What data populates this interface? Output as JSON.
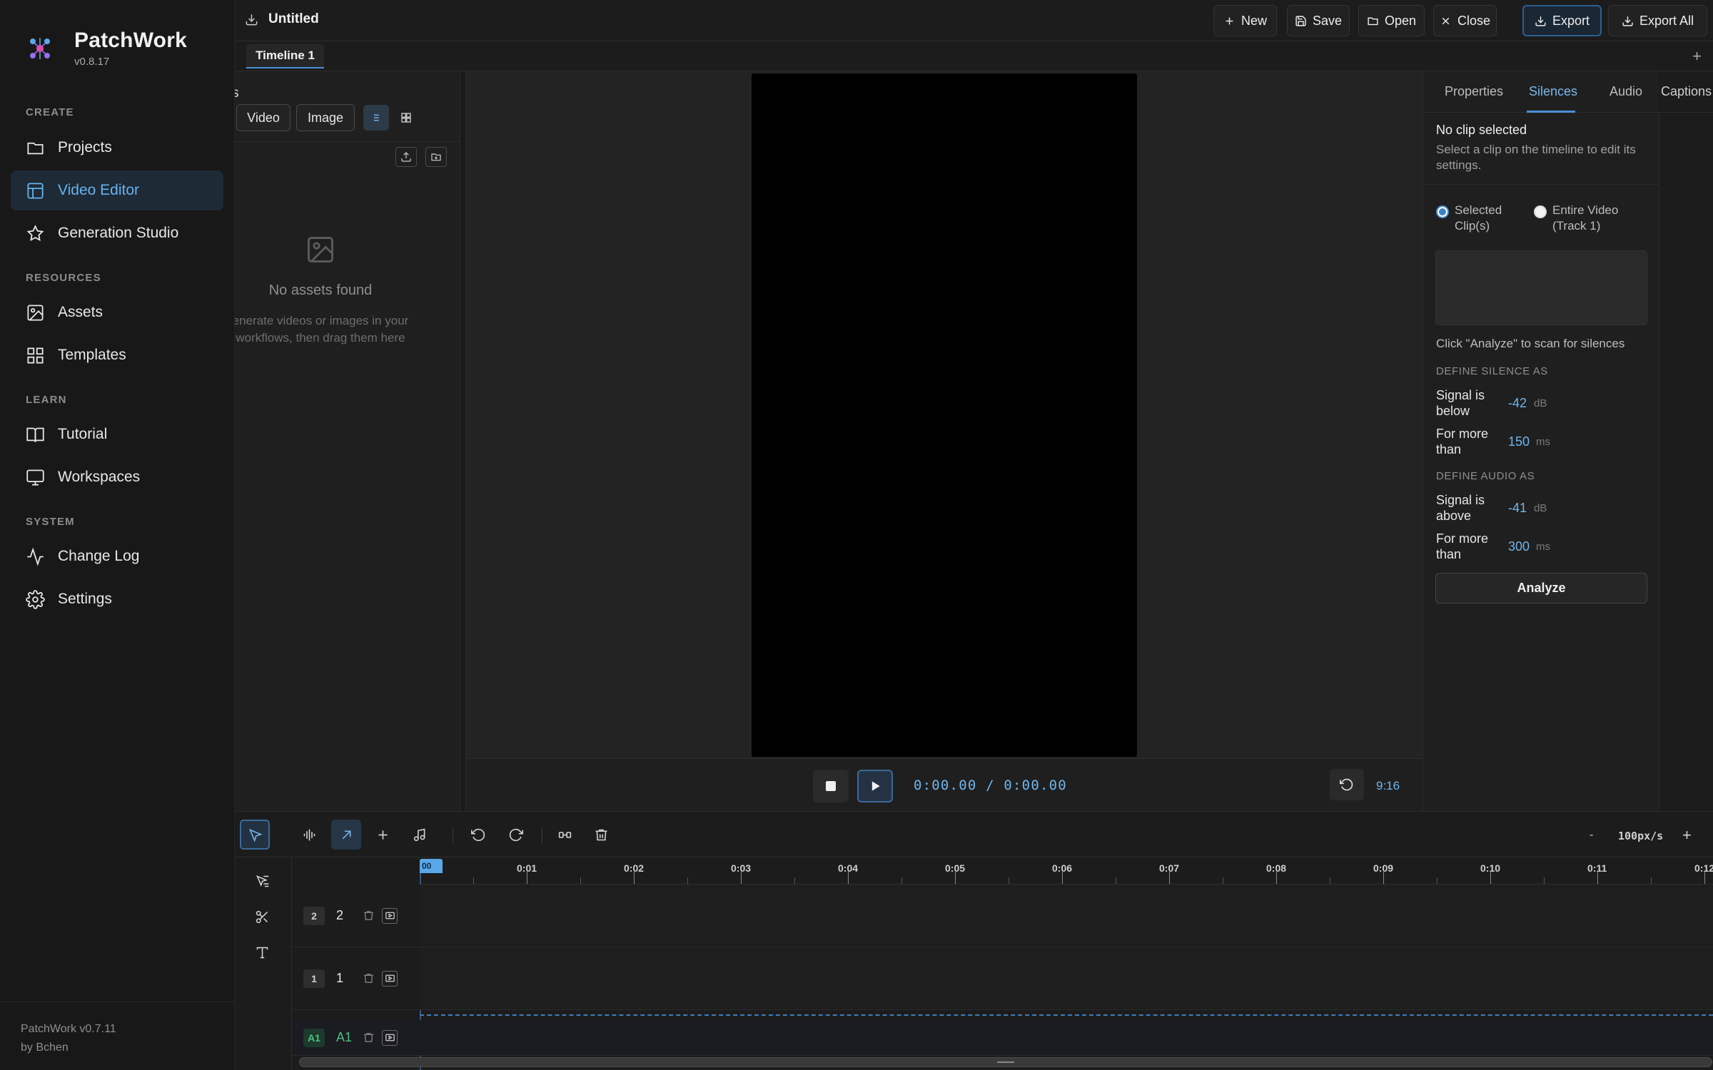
{
  "app": {
    "name": "PatchWork",
    "version": "v0.8.17"
  },
  "sidebar": {
    "sections": [
      {
        "label": "CREATE"
      },
      {
        "label": "RESOURCES"
      },
      {
        "label": "LEARN"
      },
      {
        "label": "SYSTEM"
      }
    ],
    "items": [
      {
        "label": "Projects",
        "icon": "folder-icon"
      },
      {
        "label": "Video Editor",
        "icon": "layout-icon",
        "active": true
      },
      {
        "label": "Generation Studio",
        "icon": "star-icon"
      },
      {
        "label": "Assets",
        "icon": "image-icon"
      },
      {
        "label": "Templates",
        "icon": "grid-icon"
      },
      {
        "label": "Tutorial",
        "icon": "book-icon"
      },
      {
        "label": "Workspaces",
        "icon": "monitor-icon"
      },
      {
        "label": "Change Log",
        "icon": "activity-icon"
      },
      {
        "label": "Settings",
        "icon": "gear-icon"
      }
    ],
    "footer": {
      "line1": "PatchWork v0.7.11",
      "line2": "by Bchen"
    }
  },
  "topbar": {
    "doc_title": "Untitled",
    "buttons": {
      "new": "New",
      "save": "Save",
      "open": "Open",
      "close": "Close",
      "export": "Export",
      "export_all": "Export All"
    }
  },
  "tabs": {
    "active": "Timeline 1",
    "add": "+"
  },
  "assets": {
    "title_fragment": "s",
    "filters": [
      "Video",
      "Image"
    ],
    "empty_title": "No assets found",
    "empty_sub_line1": "enerate videos or images in your",
    "empty_sub_line2": "workflows, then drag them here"
  },
  "preview": {
    "time_current": "0:00.00",
    "time_sep": "/",
    "time_total": "0:00.00",
    "aspect_ratio": "9:16"
  },
  "right_panel": {
    "tabs": [
      "Properties",
      "Silences",
      "Audio",
      "Captions"
    ],
    "active_tab": "Silences",
    "no_clip_title": "No clip selected",
    "no_clip_sub": "Select a clip on the timeline to edit its settings.",
    "radio_selected_line1": "Selected",
    "radio_selected_line2": "Clip(s)",
    "radio_entire_line1": "Entire Video",
    "radio_entire_line2": "(Track 1)",
    "hint": "Click \"Analyze\" to scan for silences",
    "define_silence": "DEFINE SILENCE AS",
    "define_audio": "DEFINE AUDIO AS",
    "silence_signal_line1": "Signal is",
    "silence_signal_line2": "below",
    "silence_signal_val": "-42",
    "silence_signal_unit": "dB",
    "silence_more_line1": "For more",
    "silence_more_line2": "than",
    "silence_more_val": "150",
    "silence_more_unit": "ms",
    "audio_signal_line1": "Signal is",
    "audio_signal_line2": "above",
    "audio_signal_val": "-41",
    "audio_signal_unit": "dB",
    "audio_more_line1": "For more",
    "audio_more_line2": "than",
    "audio_more_val": "300",
    "audio_more_unit": "ms",
    "analyze": "Analyze"
  },
  "timeline": {
    "zoom_minus": "-",
    "zoom_value": "100px/s",
    "zoom_plus": "+",
    "playhead_label": "00",
    "ruler_labels": [
      "0:01",
      "0:02",
      "0:03",
      "0:04",
      "0:05",
      "0:06",
      "0:07",
      "0:08",
      "0:09",
      "0:10",
      "0:11",
      "0:12"
    ],
    "tracks": [
      {
        "badge": "2",
        "name": "2"
      },
      {
        "badge": "1",
        "name": "1"
      },
      {
        "badge": "A1",
        "name": "A1"
      }
    ]
  },
  "colors": {
    "accent": "#4a90d9",
    "accent_text": "#6fb6ee",
    "audio": "#4fbf7f",
    "background": "#1f1f1f"
  }
}
